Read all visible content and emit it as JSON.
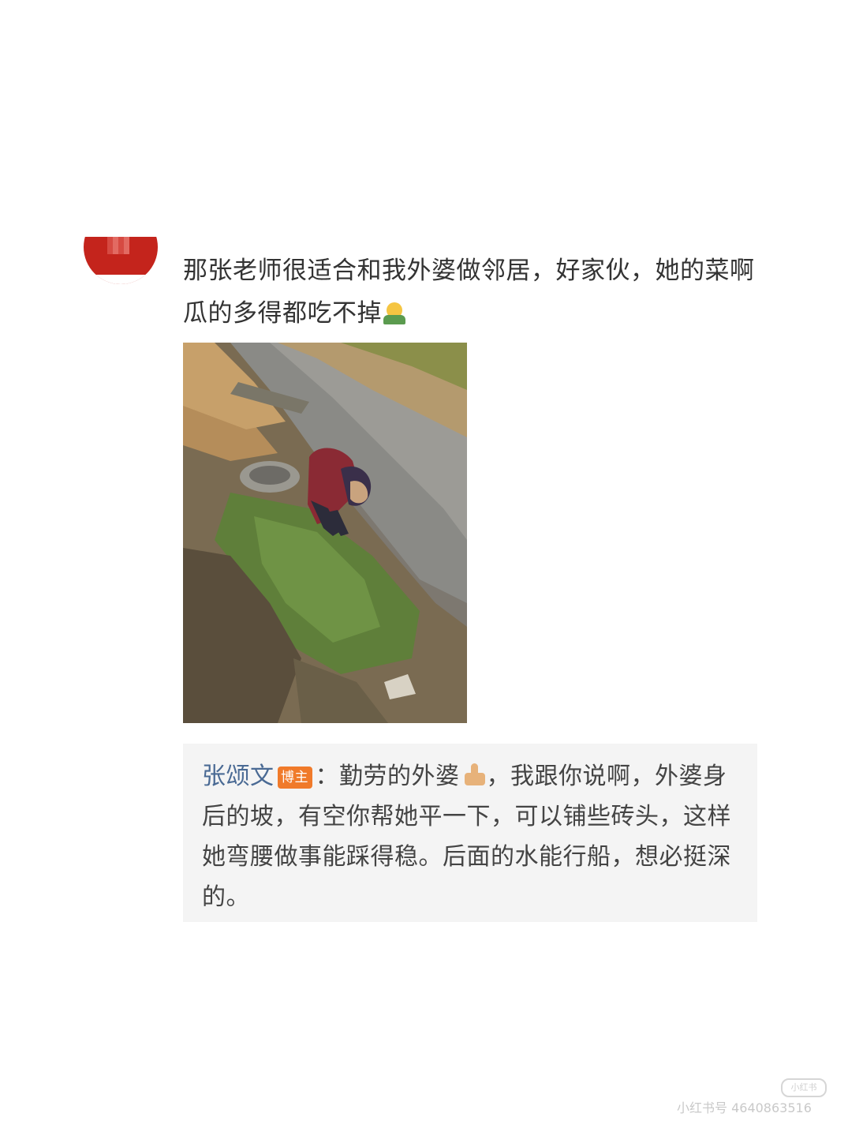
{
  "comment": {
    "text": "那张老师很适合和我外婆做邻居，好家伙，她的菜啊瓜的多得都吃不掉"
  },
  "photo": {
    "description_icon": "photo-image"
  },
  "reply": {
    "author": "张颂文",
    "badge": "博主",
    "colon": "：",
    "text_part1": "勤劳的外婆",
    "text_part2": "，我跟你说啊，外婆身后的坡，有空你帮她平一下，可以铺些砖头，这样她弯腰做事能踩得稳。后面的水能行船，想必挺深的。"
  },
  "watermark": {
    "logo": "小红书",
    "text": "小红书号 4640863516"
  },
  "colors": {
    "reply_name": "#4a6a94",
    "badge": "#f07a2a",
    "reply_bg": "#f4f4f4"
  }
}
